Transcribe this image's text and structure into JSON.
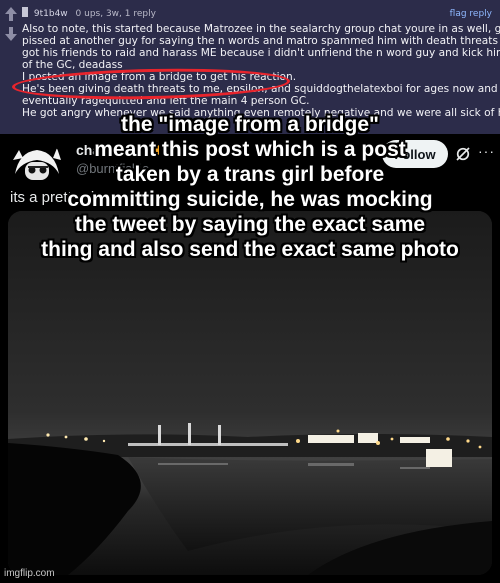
{
  "comment": {
    "author": "9t1b4w",
    "meta": "0 ups, 3w, 1 reply",
    "flag_label": "flag reply",
    "lines": [
      "Also to note, this started because Matrozee in the sealarchy group chat youre in as well, got",
      "pissed at another guy for saying the n words and matro spammed him with death threats and",
      "got his friends to raid and harass ME because i didn't unfriend the n word guy and kick him out",
      "of the GC, deadass",
      "I posted an image from a bridge to get his reaction.",
      "He's been giving death threats to me, epsilon, and squiddogthelatexboi for ages now and he",
      "eventually ragequitted and left the main 4 person GC.",
      "He got angry whenever we said anything even remotely negative and we were all sick of him"
    ],
    "highlight_color": "#e8242c"
  },
  "tweet": {
    "display_name": "charlotte",
    "handle": "@burntfishie",
    "follow_label": "Follow",
    "text": "its a pretty view",
    "icons": [
      "verified-fish-icon",
      "grok-icon",
      "more-icon"
    ]
  },
  "caption": [
    "the \"image from a bridge\"",
    "meant this post which is a post",
    "taken by a trans girl before",
    "committing suicide, he was mocking",
    "the tweet by saying the exact same",
    "thing and also send the exact same photo"
  ],
  "watermark": "imgflip.com"
}
